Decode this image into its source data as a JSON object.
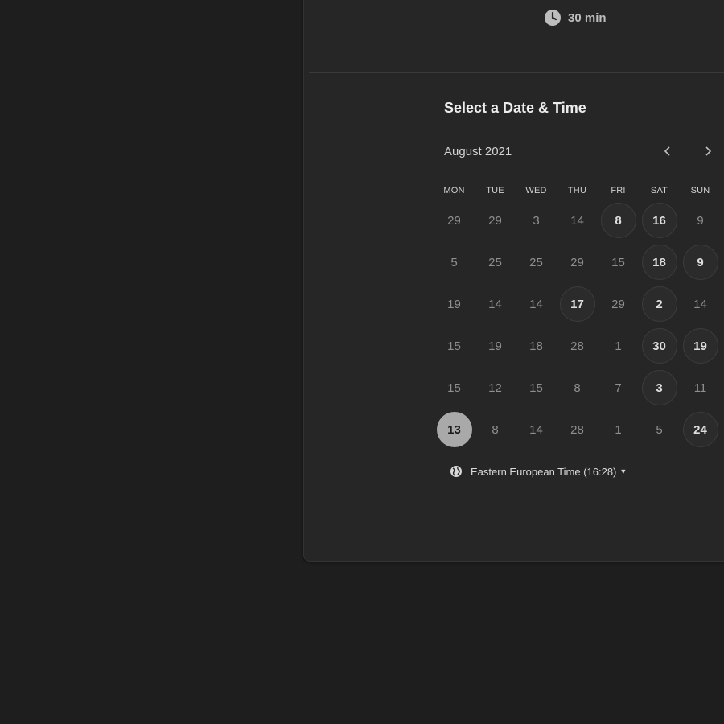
{
  "event": {
    "duration": "30 min"
  },
  "calendar": {
    "title": "Select a Date & Time",
    "month": "August 2021",
    "weekdays": [
      "MON",
      "TUE",
      "WED",
      "THU",
      "FRI",
      "SAT",
      "SUN"
    ],
    "weeks": [
      [
        {
          "d": "29",
          "s": ""
        },
        {
          "d": "29",
          "s": ""
        },
        {
          "d": "3",
          "s": ""
        },
        {
          "d": "14",
          "s": ""
        },
        {
          "d": "8",
          "s": "available"
        },
        {
          "d": "16",
          "s": "available"
        },
        {
          "d": "9",
          "s": ""
        }
      ],
      [
        {
          "d": "5",
          "s": ""
        },
        {
          "d": "25",
          "s": ""
        },
        {
          "d": "25",
          "s": ""
        },
        {
          "d": "29",
          "s": ""
        },
        {
          "d": "15",
          "s": ""
        },
        {
          "d": "18",
          "s": "available"
        },
        {
          "d": "9",
          "s": "available"
        }
      ],
      [
        {
          "d": "19",
          "s": ""
        },
        {
          "d": "14",
          "s": ""
        },
        {
          "d": "14",
          "s": ""
        },
        {
          "d": "17",
          "s": "available"
        },
        {
          "d": "29",
          "s": ""
        },
        {
          "d": "2",
          "s": "available"
        },
        {
          "d": "14",
          "s": ""
        }
      ],
      [
        {
          "d": "15",
          "s": ""
        },
        {
          "d": "19",
          "s": ""
        },
        {
          "d": "18",
          "s": ""
        },
        {
          "d": "28",
          "s": ""
        },
        {
          "d": "1",
          "s": ""
        },
        {
          "d": "30",
          "s": "available"
        },
        {
          "d": "19",
          "s": "available"
        }
      ],
      [
        {
          "d": "15",
          "s": ""
        },
        {
          "d": "12",
          "s": ""
        },
        {
          "d": "15",
          "s": ""
        },
        {
          "d": "8",
          "s": ""
        },
        {
          "d": "7",
          "s": ""
        },
        {
          "d": "3",
          "s": "available"
        },
        {
          "d": "11",
          "s": ""
        }
      ],
      [
        {
          "d": "13",
          "s": "selected"
        },
        {
          "d": "8",
          "s": ""
        },
        {
          "d": "14",
          "s": ""
        },
        {
          "d": "28",
          "s": ""
        },
        {
          "d": "1",
          "s": ""
        },
        {
          "d": "5",
          "s": ""
        },
        {
          "d": "24",
          "s": "available"
        }
      ]
    ]
  },
  "timezone": {
    "label": "Eastern European Time (16:28)",
    "icon": "globe-icon"
  },
  "colors": {
    "background": "#1e1e1e",
    "panel": "#262626",
    "selected": "#a9a9a9"
  }
}
